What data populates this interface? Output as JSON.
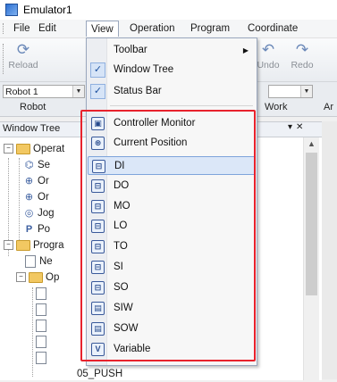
{
  "window": {
    "title": "Emulator1"
  },
  "menubar": {
    "items": [
      "File",
      "Edit",
      "View",
      "Operation",
      "Program",
      "Coordinate System"
    ]
  },
  "toolbar": {
    "reload": "Reload",
    "undo": "Undo",
    "redo": "Redo"
  },
  "selector": {
    "robot_value": "Robot 1",
    "groups": {
      "robot": "Robot",
      "work": "Work",
      "ar": "Ar"
    }
  },
  "tree": {
    "title": "Window Tree",
    "rows": [
      {
        "label": "Operat",
        "kind": "folder"
      },
      {
        "label": "Se",
        "kind": "node"
      },
      {
        "label": "Or",
        "kind": "node"
      },
      {
        "label": "Or",
        "kind": "node"
      },
      {
        "label": "Jog",
        "kind": "node"
      },
      {
        "label": "Po",
        "kind": "node"
      },
      {
        "label": "Progra",
        "kind": "folder"
      },
      {
        "label": "Ne",
        "kind": "doc"
      },
      {
        "label": "Op",
        "kind": "folder"
      },
      {
        "label": "05_PUSH",
        "kind": "doc"
      }
    ]
  },
  "view_menu": {
    "toolbar": "Toolbar",
    "window_tree": "Window Tree",
    "status_bar": "Status Bar",
    "controller_monitor": "Controller Monitor",
    "current_position": "Current Position",
    "di": "DI",
    "do": "DO",
    "mo": "MO",
    "lo": "LO",
    "to": "TO",
    "si": "SI",
    "so": "SO",
    "siw": "SIW",
    "sow": "SOW",
    "variable": "Variable"
  },
  "colors": {
    "highlight_box": "#e8222c",
    "menu_highlight": "#dbe7f8"
  }
}
